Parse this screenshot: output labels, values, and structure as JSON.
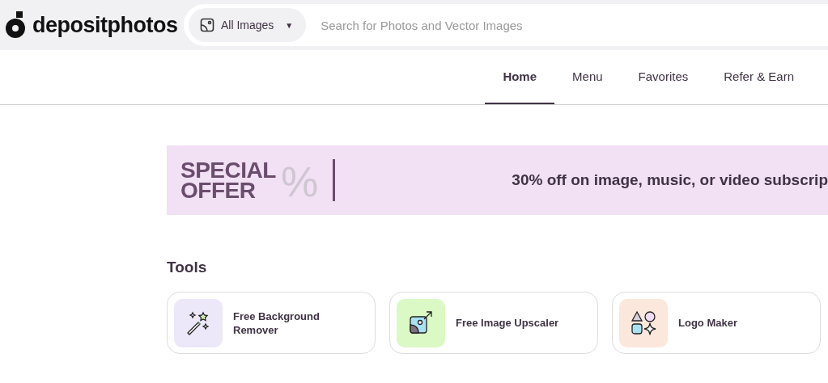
{
  "header": {
    "logo": "depositphotos",
    "category": {
      "label": "All Images",
      "caret": "▼"
    },
    "search": {
      "placeholder": "Search for Photos and Vector Images"
    }
  },
  "nav": [
    {
      "label": "Home",
      "selected": true
    },
    {
      "label": "Menu",
      "selected": false
    },
    {
      "label": "Favorites",
      "selected": false
    },
    {
      "label": "Refer & Earn",
      "selected": false
    }
  ],
  "banner": {
    "title_line_1": "SPECIAL",
    "title_line_2": "OFFER",
    "percent": "%",
    "text": "30% off on image, music, or video subscrip"
  },
  "tools": {
    "title": "Tools",
    "items": [
      {
        "kind": "wand",
        "label": "Free Background Remover",
        "color": "#ece8fa"
      },
      {
        "kind": "upscale",
        "label": "Free Image Upscaler",
        "color": "#dbf9c4"
      },
      {
        "kind": "shapes",
        "label": "Logo Maker",
        "color": "#fbe7dc"
      }
    ]
  }
}
